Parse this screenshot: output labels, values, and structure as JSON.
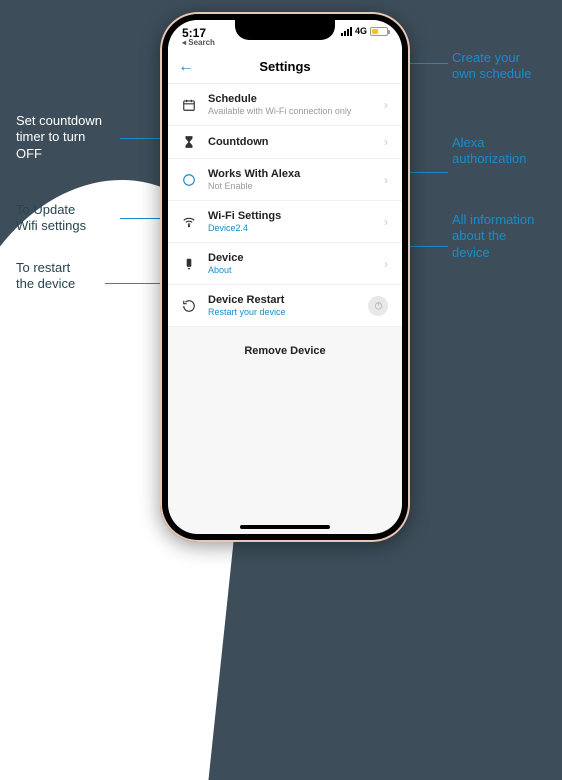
{
  "status": {
    "time": "5:17",
    "search_label": "Search",
    "network": "4G"
  },
  "header": {
    "title": "Settings"
  },
  "rows": {
    "schedule": {
      "title": "Schedule",
      "sub": "Available with Wi-Fi connection only"
    },
    "countdown": {
      "title": "Countdown"
    },
    "alexa": {
      "title": "Works With Alexa",
      "sub": "Not Enable"
    },
    "wifi": {
      "title": "Wi-Fi Settings",
      "sub": "Device2.4"
    },
    "device": {
      "title": "Device",
      "sub": "About"
    },
    "restart": {
      "title": "Device Restart",
      "sub": "Restart your device"
    }
  },
  "remove_label": "Remove Device",
  "annotations": {
    "create_schedule": "Create your\nown schedule",
    "alexa_auth": "Alexa\nauthorization",
    "device_info": "All information\nabout the\ndevice",
    "countdown_off": "Set countdown\ntimer to turn\nOFF",
    "update_wifi": "To Update\nWifi settings",
    "restart_device": "To restart\nthe device"
  }
}
